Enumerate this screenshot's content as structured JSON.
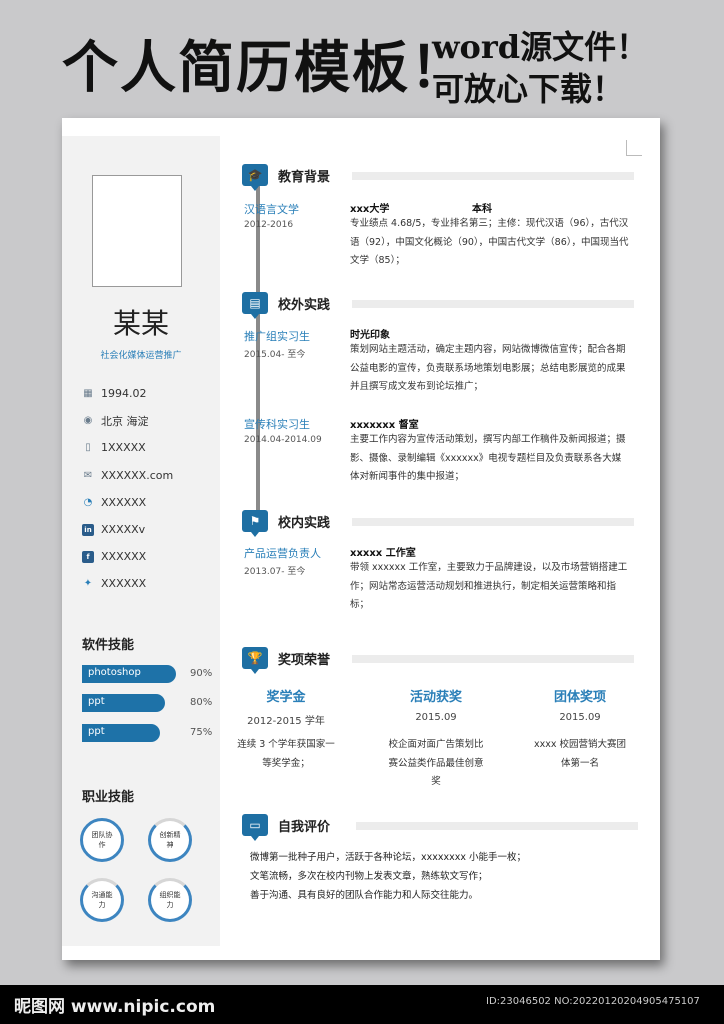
{
  "banner": {
    "left": "个人简历模板！",
    "right_line1": "word源文件！",
    "right_line2": "可放心下载！"
  },
  "profile": {
    "name": "某某",
    "title": "社会化媒体运营推广"
  },
  "contacts": [
    {
      "icon": "calendar-icon",
      "glyph": "▦",
      "text": "1994.02"
    },
    {
      "icon": "location-icon",
      "glyph": "◉",
      "text": "北京 海淀"
    },
    {
      "icon": "phone-icon",
      "glyph": "▯",
      "text": "1XXXXX"
    },
    {
      "icon": "mail-icon",
      "glyph": "✉",
      "text": "XXXXXX.com"
    },
    {
      "icon": "weibo-icon",
      "glyph": "◔",
      "text": "XXXXXX"
    },
    {
      "icon": "linkedin-icon",
      "glyph": "in",
      "text": "XXXXXv"
    },
    {
      "icon": "facebook-icon",
      "glyph": "f",
      "text": "XXXXXX"
    },
    {
      "icon": "twitter-icon",
      "glyph": "✦",
      "text": "XXXXXX"
    }
  ],
  "software": {
    "heading": "软件技能",
    "items": [
      {
        "label": "photoshop",
        "percent": "90%",
        "level": 0.9
      },
      {
        "label": "ppt",
        "percent": "80%",
        "level": 0.8
      },
      {
        "label": "ppt",
        "percent": "75%",
        "level": 0.75
      }
    ]
  },
  "career": {
    "heading": "职业技能",
    "items": [
      "团队协作",
      "创新精神",
      "沟通能力",
      "组织能力"
    ]
  },
  "education": {
    "heading": "教育背景",
    "role": "汉语言文学",
    "date": "2012-2016",
    "school": "xxx大学",
    "degree": "本科",
    "desc": "专业绩点 4.68/5，专业排名第三；主修：现代汉语（96），古代汉语（92），中国文化概论（90），中国古代文学（86），中国现当代文学（85）；"
  },
  "external": {
    "heading": "校外实践",
    "entries": [
      {
        "role": "推广组实习生",
        "date": "2015.04- 至今",
        "org": "时光印象",
        "desc": "策划网站主题活动，确定主题内容，网站微博微信宣传；配合各期公益电影的宣传，负责联系场地策划电影展；总结电影展览的成果并且撰写成文发布到论坛推广；"
      },
      {
        "role": "宣传科实习生",
        "date": "2014.04-2014.09",
        "org": "xxxxxxx 督室",
        "desc": "主要工作内容为宣传活动策划，撰写内部工作稿件及新闻报道；摄影、摄像、录制编辑《xxxxxx》电视专题栏目及负责联系各大媒体对新闻事件的集中报道；"
      }
    ]
  },
  "internal": {
    "heading": "校内实践",
    "role": "产品运营负责人",
    "date": "2013.07- 至今",
    "org": "xxxxx 工作室",
    "desc": "带领 xxxxxx 工作室，主要致力于品牌建设，以及市场营销搭建工作；网站常态运营活动规划和推进执行，制定相关运营策略和指标；"
  },
  "awards": {
    "heading": "奖项荣誉",
    "items": [
      {
        "name": "奖学金",
        "date": "2012-2015 学年",
        "desc": "连续 3 个学年获国家一等奖学金；"
      },
      {
        "name": "活动获奖",
        "date": "2015.09",
        "desc": "校企面对面广告策划比赛公益类作品最佳创意奖"
      },
      {
        "name": "团体奖项",
        "date": "2015.09",
        "desc": "xxxx 校园营销大赛团体第一名"
      }
    ]
  },
  "self": {
    "heading": "自我评价",
    "lines": [
      "微博第一批种子用户，活跃于各种论坛，xxxxxxxx 小能手一枚；",
      "文笔流畅，多次在校内刊物上发表文章，熟练软文写作；",
      "善于沟通、具有良好的团队合作能力和人际交往能力。"
    ]
  },
  "watermark": {
    "left": "昵图网 www.nipic.com",
    "right": "ID:23046502 NO:20220120204905475107"
  },
  "colors": {
    "accent": "#1e72a8",
    "link_blue": "#2a7fb8",
    "sidebar_bg": "#f2f2f2"
  }
}
